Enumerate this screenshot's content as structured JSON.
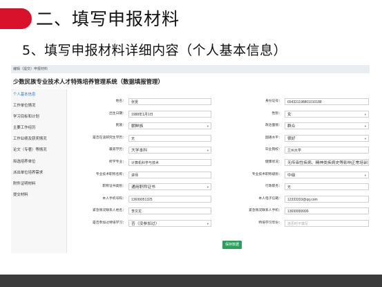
{
  "slide": {
    "title": "二、填写申报材料",
    "subtitle": "5、填写申报材料详细内容（个人基本信息）"
  },
  "app": {
    "breadcrumb": "编辑（提交）申报材料",
    "system_title": "少数民族专业技术人才特殊培养管理系统（数据填报管理）"
  },
  "sidebar": {
    "items": [
      {
        "label": "个人基本信息",
        "active": true
      },
      {
        "label": "工作单位情况"
      },
      {
        "label": "学习目标和计划"
      },
      {
        "label": "主要工作经历"
      },
      {
        "label": "工作业绩及获奖情况"
      },
      {
        "label": "论文（专著）等情况"
      },
      {
        "label": "拟选培养单位"
      },
      {
        "label": "派出单位培养需求"
      },
      {
        "label": "附件证明材料"
      },
      {
        "label": "提交材料"
      }
    ]
  },
  "form": {
    "rows": [
      {
        "left": {
          "label": "姓名：",
          "value": "张雯"
        },
        "right": {
          "label": "身份证号：",
          "value": "654321198801010188"
        }
      },
      {
        "left": {
          "label": "出生日期：",
          "value": "1988年1月1日"
        },
        "right": {
          "label": "性别：",
          "value": "女",
          "select": true
        }
      },
      {
        "left": {
          "label": "民族：",
          "value": "朝鲜族",
          "select": true
        },
        "right": {
          "label": "政治面貌：",
          "value": "群众",
          "select": true
        }
      },
      {
        "left": {
          "label": "是否在读研究生学历：",
          "value": "无"
        },
        "right": {
          "label": "国语水平：",
          "value": "很好",
          "select": true
        }
      },
      {
        "left": {
          "label": "最高学历：",
          "value": "大学本科",
          "select": true
        },
        "right": {
          "label": "毕业院校：",
          "value": "兰州大学"
        }
      },
      {
        "left": {
          "label": "所学专业：",
          "value": "计算机科学与技术"
        },
        "right": {
          "label": "健康状况：",
          "value": "无传染性疾病、精神类疾病史等影响正常培训",
          "select": true
        }
      },
      {
        "left": {
          "label": "专业技术职称名称：",
          "value": "讲师"
        },
        "right": {
          "label": "专业技术职称级别：",
          "value": "中级",
          "select": true
        }
      },
      {
        "left": {
          "label": "职称证书类别：",
          "value": "通用职称证书",
          "select": true
        },
        "right": {
          "label": "行政职务：",
          "value": "无"
        }
      },
      {
        "left": {
          "label": "本人手机号码：",
          "value": "13699051325"
        },
        "right": {
          "label": "本人电子信箱：",
          "value": "12333333@qq.com"
        }
      },
      {
        "left": {
          "label": "紧急情况联系人姓名：",
          "value": "李文龙"
        },
        "right": {
          "label": "紧急情况联系人手机：",
          "value": "13699999999"
        }
      },
      {
        "left": {
          "label": "是否参加过特培学习：",
          "value": "否（没参加过）",
          "select": true
        },
        "right": {
          "label": "特培学习年份：",
          "value": "",
          "placeholder": "选否时不填写"
        }
      }
    ],
    "save_label": "保存数据"
  }
}
